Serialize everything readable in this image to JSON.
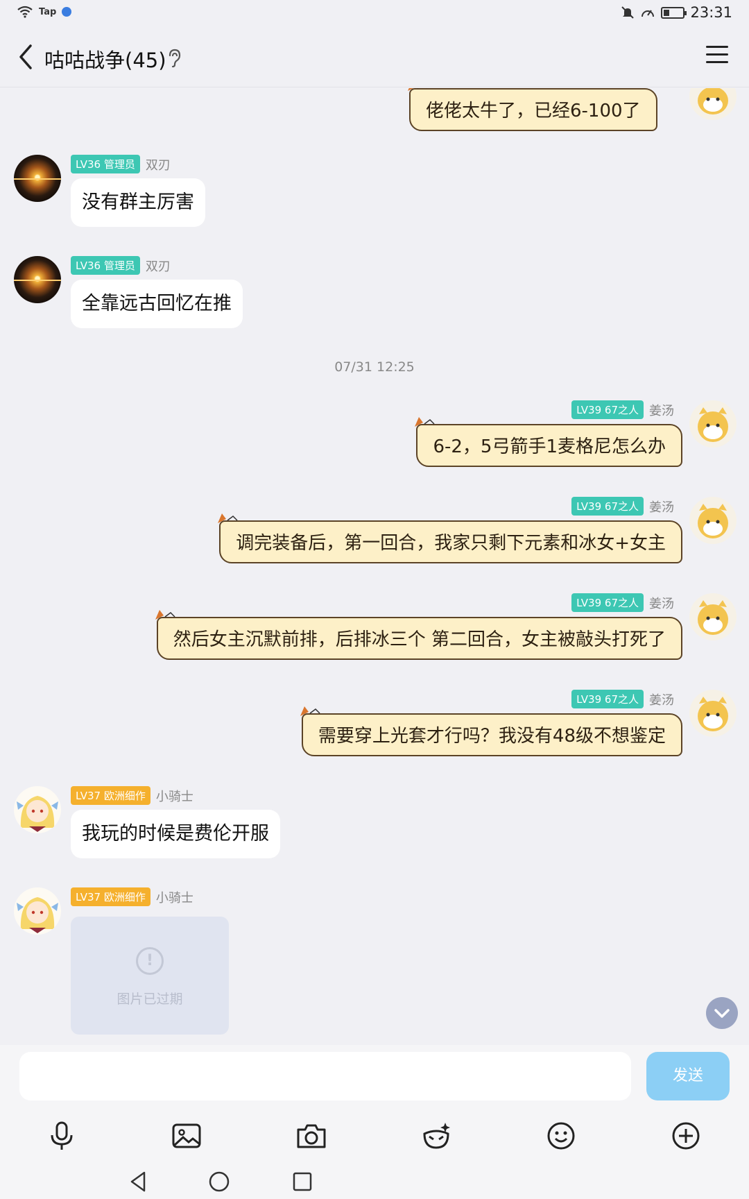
{
  "status_bar": {
    "carrier_text": "Tap",
    "time": "23:31",
    "battery_level": 0.3,
    "icons": [
      "wifi-icon",
      "tap-app-icon",
      "globe-icon",
      "mute-bell-icon",
      "speed-icon",
      "battery-icon"
    ]
  },
  "header": {
    "title": "咕咕战争(45)",
    "icons": [
      "back-arrow-icon",
      "ear-icon",
      "menu-icon"
    ]
  },
  "messages": [
    {
      "side": "right",
      "style": "scroll",
      "text": "佬佬太牛了，已经6-100了"
    },
    {
      "side": "left",
      "style": "white",
      "avatar": "sunset-avatar",
      "badge": "LV36 管理员",
      "badge_color": "#3dc7b3",
      "nick": "双刃",
      "text": "没有群主厉害"
    },
    {
      "side": "left",
      "style": "white",
      "avatar": "sunset-avatar",
      "badge": "LV36 管理员",
      "badge_color": "#3dc7b3",
      "nick": "双刃",
      "text": "全靠远古回忆在推"
    },
    {
      "style": "timestamp",
      "text": "07/31 12:25"
    },
    {
      "side": "right",
      "style": "scroll",
      "avatar": "cat-avatar",
      "badge": "LV39 67之人",
      "badge_color": "#3dc7b3",
      "nick": "姜汤",
      "text": "6-2，5弓箭手1麦格尼怎么办"
    },
    {
      "side": "right",
      "style": "scroll",
      "avatar": "cat-avatar",
      "badge": "LV39 67之人",
      "badge_color": "#3dc7b3",
      "nick": "姜汤",
      "text": "调完装备后，第一回合，我家只剩下元素和冰女+女主"
    },
    {
      "side": "right",
      "style": "scroll",
      "avatar": "cat-avatar",
      "badge": "LV39 67之人",
      "badge_color": "#3dc7b3",
      "nick": "姜汤",
      "text": "然后女主沉默前排，后排冰三个 第二回合，女主被敲头打死了"
    },
    {
      "side": "right",
      "style": "scroll",
      "avatar": "cat-avatar",
      "badge": "LV39 67之人",
      "badge_color": "#3dc7b3",
      "nick": "姜汤",
      "text": "需要穿上光套才行吗？我没有48级不想鉴定"
    },
    {
      "side": "left",
      "style": "white",
      "avatar": "girl-avatar",
      "badge": "LV37 欧洲细作",
      "badge_color": "#f5b02d",
      "nick": "小骑士",
      "text": "我玩的时候是费伦开服"
    },
    {
      "side": "left",
      "style": "expired-image",
      "avatar": "girl-avatar",
      "badge": "LV37 欧洲细作",
      "badge_color": "#f5b02d",
      "nick": "小骑士",
      "text": "图片已过期"
    }
  ],
  "input": {
    "value": "",
    "placeholder": "",
    "send_label": "发送"
  },
  "toolbar": {
    "icons": [
      "microphone-icon",
      "image-icon",
      "camera-icon",
      "sticker-icon",
      "emoji-icon",
      "plus-icon"
    ]
  },
  "navbar": {
    "icons": [
      "nav-back-icon",
      "nav-home-icon",
      "nav-recent-icon"
    ]
  },
  "colors": {
    "background": "#f0f0f4",
    "scroll_bubble": "#fdf0c8",
    "send_button": "#8ccff5",
    "badge_green": "#3dc7b3",
    "badge_orange": "#f5b02d"
  }
}
